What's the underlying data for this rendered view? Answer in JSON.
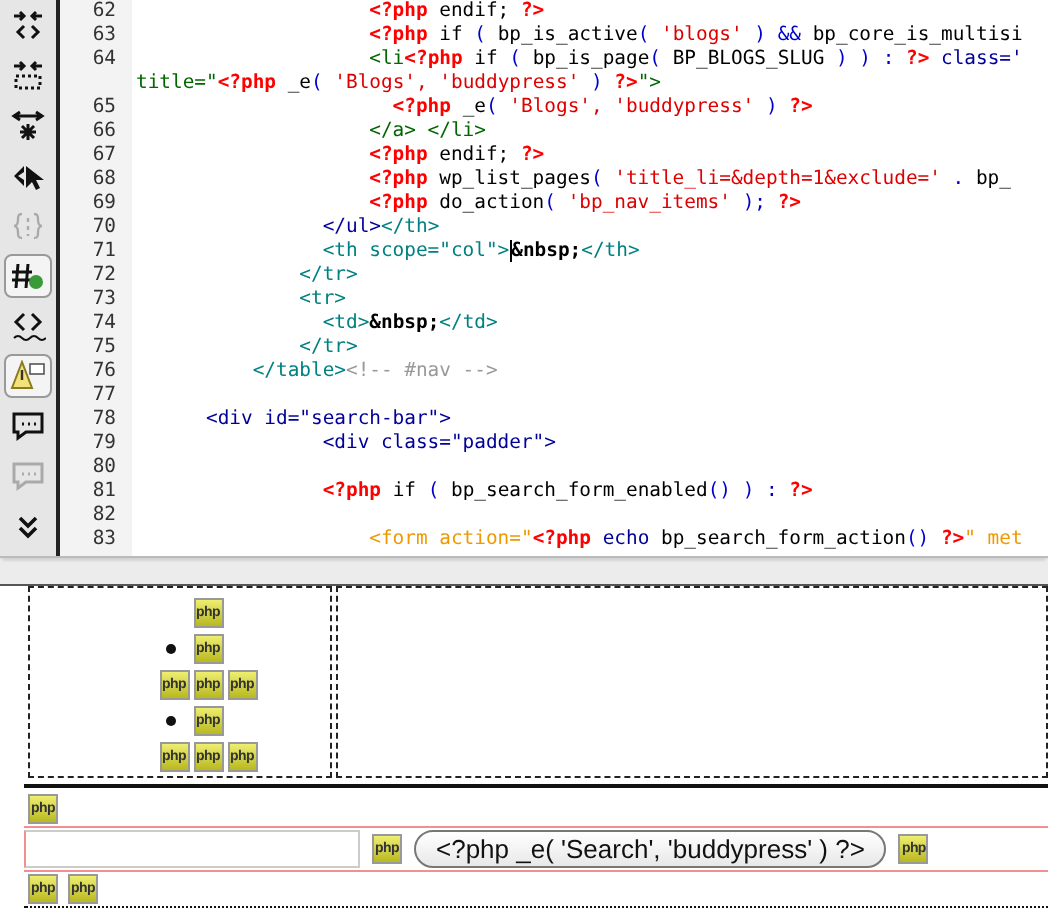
{
  "toolbar": [
    {
      "kind": "collapse-tag",
      "pressed": false,
      "disabled": false
    },
    {
      "kind": "collapse-selection",
      "pressed": false,
      "disabled": false
    },
    {
      "kind": "expand-all",
      "pressed": false,
      "disabled": false
    },
    {
      "kind": "select-parent",
      "pressed": false,
      "disabled": false
    },
    {
      "kind": "balance-braces",
      "pressed": false,
      "disabled": true
    },
    {
      "kind": "highlight-invalid",
      "pressed": true,
      "disabled": false
    },
    {
      "kind": "syntax-error",
      "pressed": false,
      "disabled": false
    },
    {
      "kind": "warning",
      "pressed": true,
      "disabled": false
    },
    {
      "kind": "comment",
      "pressed": false,
      "disabled": false
    },
    {
      "kind": "remove-comment",
      "pressed": false,
      "disabled": true
    },
    {
      "kind": "more",
      "pressed": false,
      "disabled": false
    }
  ],
  "code_lines": [
    {
      "number": "62",
      "segments": [
        {
          "kind": "php",
          "text": "                    <?php"
        },
        {
          "kind": "text",
          "text": " endif;"
        },
        {
          "kind": "php",
          "text": " ?>"
        }
      ]
    },
    {
      "number": "63",
      "segments": [
        {
          "kind": "php",
          "text": "                    <?php"
        },
        {
          "kind": "text",
          "text": " if "
        },
        {
          "kind": "op",
          "text": "("
        },
        {
          "kind": "text",
          "text": " bp_is_active"
        },
        {
          "kind": "op",
          "text": "("
        },
        {
          "kind": "string",
          "text": " 'blogs'"
        },
        {
          "kind": "op",
          "text": " ) &&"
        },
        {
          "kind": "text",
          "text": " bp_core_is_multisi"
        }
      ]
    },
    {
      "number": "64",
      "segments": [
        {
          "kind": "tag-green",
          "text": "                    <li"
        },
        {
          "kind": "php",
          "text": "<?php"
        },
        {
          "kind": "text",
          "text": " if "
        },
        {
          "kind": "op",
          "text": "("
        },
        {
          "kind": "text",
          "text": " bp_is_page"
        },
        {
          "kind": "op",
          "text": "("
        },
        {
          "kind": "text",
          "text": " BP_BLOGS_SLUG"
        },
        {
          "kind": "op",
          "text": " ) ) :"
        },
        {
          "kind": "php",
          "text": " ?>"
        },
        {
          "kind": "tag-navy",
          "text": " class='"
        }
      ]
    },
    {
      "segments": [
        {
          "kind": "tag-green",
          "text": "title=\""
        },
        {
          "kind": "php",
          "text": "<?php"
        },
        {
          "kind": "text",
          "text": " _e"
        },
        {
          "kind": "op",
          "text": "("
        },
        {
          "kind": "string",
          "text": " 'Blogs', 'buddypress'"
        },
        {
          "kind": "op",
          "text": " )"
        },
        {
          "kind": "php",
          "text": " ?>"
        },
        {
          "kind": "tag-green",
          "text": "\">"
        }
      ]
    },
    {
      "number": "65",
      "segments": [
        {
          "kind": "php",
          "text": "                      <?php"
        },
        {
          "kind": "text",
          "text": " _e"
        },
        {
          "kind": "op",
          "text": "("
        },
        {
          "kind": "string",
          "text": " 'Blogs', 'buddypress'"
        },
        {
          "kind": "op",
          "text": " )"
        },
        {
          "kind": "php",
          "text": " ?>"
        }
      ]
    },
    {
      "number": "66",
      "segments": [
        {
          "kind": "tag-green",
          "text": "                    </a> </li>"
        }
      ]
    },
    {
      "number": "67",
      "segments": [
        {
          "kind": "php",
          "text": "                    <?php"
        },
        {
          "kind": "text",
          "text": " endif;"
        },
        {
          "kind": "php",
          "text": " ?>"
        }
      ]
    },
    {
      "number": "68",
      "segments": [
        {
          "kind": "php",
          "text": "                    <?php"
        },
        {
          "kind": "text",
          "text": " wp_list_pages"
        },
        {
          "kind": "op",
          "text": "("
        },
        {
          "kind": "string",
          "text": " 'title_li=&depth=1&exclude='"
        },
        {
          "kind": "op",
          "text": " ."
        },
        {
          "kind": "text",
          "text": " bp_"
        }
      ]
    },
    {
      "number": "69",
      "segments": [
        {
          "kind": "php",
          "text": "                    <?php"
        },
        {
          "kind": "text",
          "text": " do_action"
        },
        {
          "kind": "op",
          "text": "("
        },
        {
          "kind": "string",
          "text": " 'bp_nav_items'"
        },
        {
          "kind": "op",
          "text": " );"
        },
        {
          "kind": "php",
          "text": " ?>"
        }
      ]
    },
    {
      "number": "70",
      "segments": [
        {
          "kind": "tag-navy",
          "text": "                </ul>"
        },
        {
          "kind": "tag-teal",
          "text": "</th>"
        }
      ]
    },
    {
      "number": "71",
      "segments": [
        {
          "kind": "tag-teal",
          "text": "                <th scope=\"col\">"
        },
        {
          "kind": "entity",
          "text": "&nbsp;",
          "cursor": true
        },
        {
          "kind": "tag-teal",
          "text": "</th>"
        }
      ]
    },
    {
      "number": "72",
      "segments": [
        {
          "kind": "tag-teal",
          "text": "              </tr>"
        }
      ]
    },
    {
      "number": "73",
      "segments": [
        {
          "kind": "tag-teal",
          "text": "              <tr>"
        }
      ]
    },
    {
      "number": "74",
      "segments": [
        {
          "kind": "tag-teal",
          "text": "                <td>"
        },
        {
          "kind": "entity",
          "text": "&nbsp;",
          "cursor": false
        },
        {
          "kind": "tag-teal",
          "text": "</td>"
        }
      ]
    },
    {
      "number": "75",
      "segments": [
        {
          "kind": "tag-teal",
          "text": "              </tr>"
        }
      ]
    },
    {
      "number": "76",
      "segments": [
        {
          "kind": "tag-teal",
          "text": "          </table>"
        },
        {
          "kind": "comment",
          "text": "<!-- #nav -->"
        }
      ]
    },
    {
      "number": "77"
    },
    {
      "number": "78",
      "segments": [
        {
          "kind": "tag-navy",
          "text": "      <div id=\"search-bar\">"
        }
      ]
    },
    {
      "number": "79",
      "segments": [
        {
          "kind": "tag-navy",
          "text": "                <div class=\"padder\">"
        }
      ]
    },
    {
      "number": "80"
    },
    {
      "number": "81",
      "segments": [
        {
          "kind": "php",
          "text": "                <?php"
        },
        {
          "kind": "text",
          "text": " if "
        },
        {
          "kind": "op",
          "text": "("
        },
        {
          "kind": "text",
          "text": " bp_search_form_enabled"
        },
        {
          "kind": "op",
          "text": "() ) :"
        },
        {
          "kind": "php",
          "text": " ?>"
        }
      ]
    },
    {
      "number": "82"
    },
    {
      "number": "83",
      "segments": [
        {
          "kind": "tag-orange",
          "text": "                    <form action=\""
        },
        {
          "kind": "php",
          "text": "<?php"
        },
        {
          "kind": "tag-navy",
          "text": " echo"
        },
        {
          "kind": "text",
          "text": " bp_search_form_action"
        },
        {
          "kind": "op",
          "text": "()"
        },
        {
          "kind": "php",
          "text": " ?>"
        },
        {
          "kind": "tag-orange",
          "text": "\" met"
        }
      ]
    }
  ],
  "design": {
    "nav_cell_rows": [
      {
        "bullet": false,
        "markers": [
          "php"
        ]
      },
      {
        "bullet": true,
        "markers": [
          "php"
        ]
      },
      {
        "bullet": false,
        "markers": [
          "php",
          "php",
          "php"
        ]
      },
      {
        "bullet": true,
        "markers": [
          "php"
        ]
      },
      {
        "bullet": false,
        "markers": [
          "php",
          "php",
          "php"
        ]
      }
    ],
    "search_bar": {
      "top_markers": [
        "php"
      ],
      "marker_before_button": "php",
      "button": "<?php _e( 'Search', 'buddypress' ) ?>",
      "marker_after_button": "php",
      "bottom_markers": [
        "php",
        "php"
      ]
    }
  }
}
